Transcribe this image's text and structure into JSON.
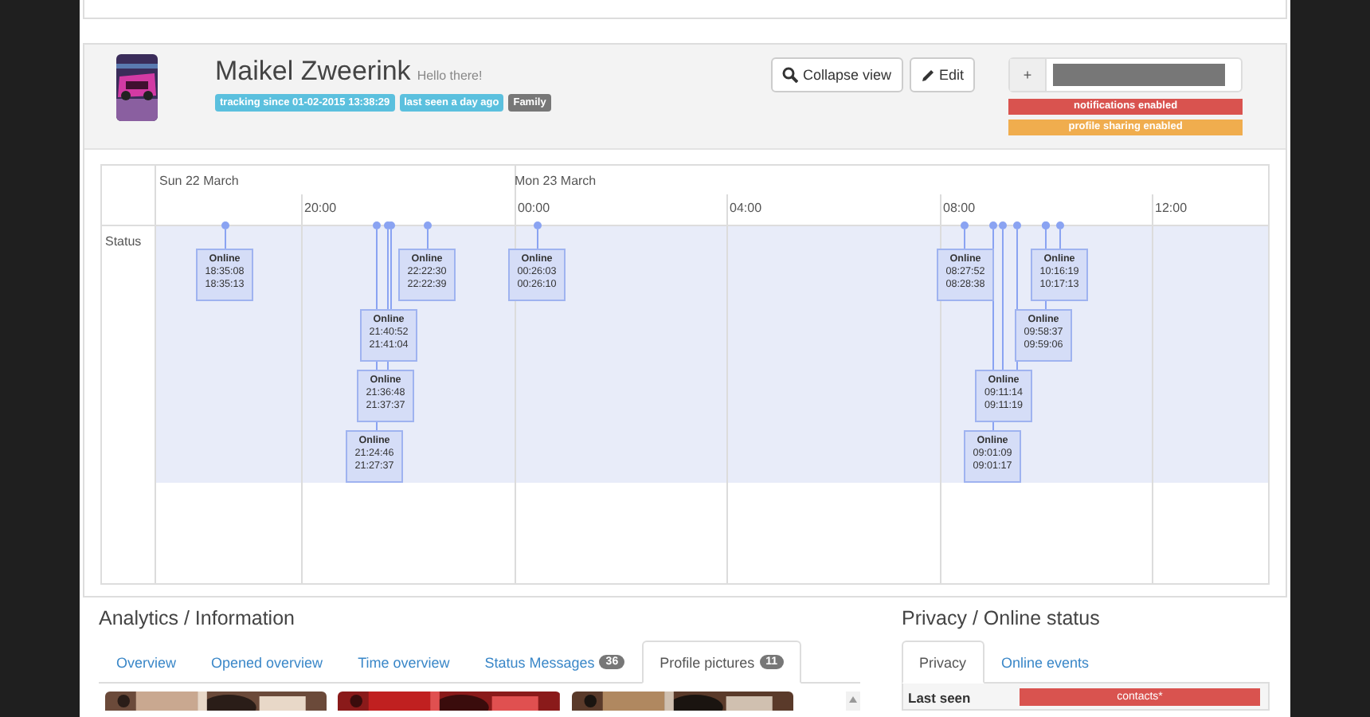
{
  "profile": {
    "name": "Maikel Zweerink",
    "status_text": "Hello there!",
    "badges": [
      {
        "text": "tracking since 01-02-2015 13:38:29",
        "color": "#5bc0de"
      },
      {
        "text": "last seen a day ago",
        "color": "#5bc0de"
      },
      {
        "text": "Family",
        "color": "#777777"
      }
    ],
    "buttons": [
      {
        "label": "Collapse view"
      },
      {
        "label": "Edit"
      }
    ],
    "phone_field": {
      "prefix": "+"
    },
    "status_labels": [
      {
        "text": "notifications enabled",
        "color": "#d9534f"
      },
      {
        "text": "profile sharing enabled",
        "color": "#f0ad4e"
      }
    ]
  },
  "timeline": {
    "dates": [
      "Sun 22 March",
      "Mon 23 March"
    ],
    "times": [
      "20:00",
      "00:00",
      "04:00",
      "08:00",
      "12:00"
    ],
    "row_label": "Status",
    "events": [
      {
        "status": "Online",
        "start": "18:35:08",
        "end": "18:35:13"
      },
      {
        "status": "Online",
        "start": "22:22:30",
        "end": "22:22:39"
      },
      {
        "status": "Online",
        "start": "00:26:03",
        "end": "00:26:10"
      },
      {
        "status": "Online",
        "start": "21:40:52",
        "end": "21:41:04"
      },
      {
        "status": "Online",
        "start": "21:36:48",
        "end": "21:37:37"
      },
      {
        "status": "Online",
        "start": "21:24:46",
        "end": "21:27:37"
      },
      {
        "status": "Online",
        "start": "08:27:52",
        "end": "08:28:38"
      },
      {
        "status": "Online",
        "start": "10:16:19",
        "end": "10:17:13"
      },
      {
        "status": "Online",
        "start": "09:58:37",
        "end": "09:59:06"
      },
      {
        "status": "Online",
        "start": "09:11:14",
        "end": "09:11:19"
      },
      {
        "status": "Online",
        "start": "09:01:09",
        "end": "09:01:17"
      }
    ]
  },
  "analytics": {
    "title": "Analytics / Information",
    "tabs": [
      {
        "label": "Overview",
        "selected": false
      },
      {
        "label": "Opened overview",
        "selected": false
      },
      {
        "label": "Time overview",
        "selected": false
      },
      {
        "label": "Status Messages",
        "count": "36",
        "selected": false
      },
      {
        "label": "Profile pictures",
        "count": "11",
        "selected": true
      }
    ]
  },
  "privacy": {
    "title": "Privacy / Online status",
    "tabs": [
      {
        "label": "Privacy",
        "selected": true
      },
      {
        "label": "Online events",
        "selected": false
      }
    ],
    "rows": [
      {
        "label": "Last seen",
        "value": "contacts*",
        "color": "#d9534f"
      }
    ]
  }
}
